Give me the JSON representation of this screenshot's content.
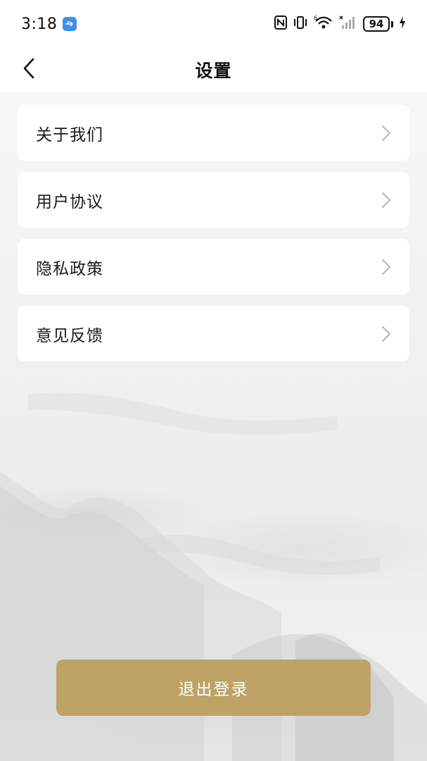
{
  "status_bar": {
    "time": "3:18",
    "battery_level": "94",
    "icons": [
      "usb-icon",
      "nfc-icon",
      "vibrate-icon",
      "wifi-icon",
      "signal-icon",
      "battery-icon",
      "charging-icon"
    ]
  },
  "header": {
    "title": "设置",
    "back_icon": "chevron-left-icon"
  },
  "menu": {
    "items": [
      {
        "label": "关于我们"
      },
      {
        "label": "用户协议"
      },
      {
        "label": "隐私政策"
      },
      {
        "label": "意见反馈"
      }
    ],
    "chevron_icon": "chevron-right-icon"
  },
  "logout": {
    "label": "退出登录"
  },
  "colors": {
    "accent": "#bda366",
    "card": "#ffffff",
    "text": "#1a1a1a",
    "chevron": "#b5b5b5",
    "usb_badge": "#3d8ef0"
  }
}
